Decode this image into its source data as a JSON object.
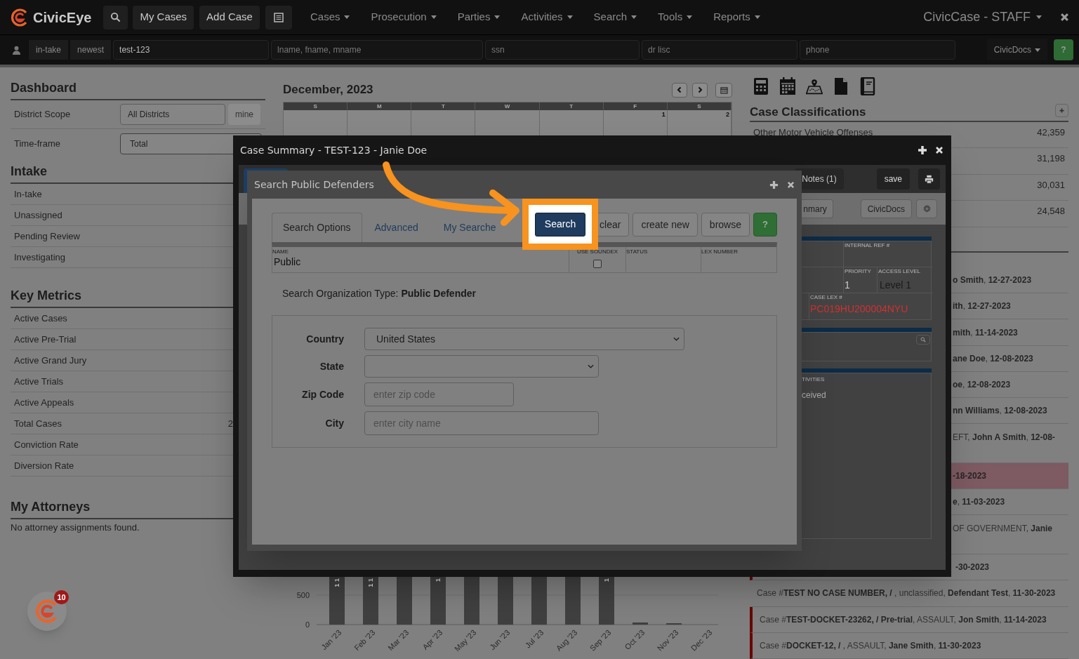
{
  "navbar": {
    "brand": "CivicEye",
    "buttons": [
      "My Cases",
      "Add Case"
    ],
    "menus": [
      "Cases",
      "Prosecution",
      "Parties",
      "Activities",
      "Search",
      "Tools",
      "Reports"
    ],
    "account": "CivicCase - STAFF"
  },
  "quick_search": {
    "buttons": [
      "in-take",
      "newest"
    ],
    "fields": [
      {
        "value": "test-123"
      },
      {
        "placeholder": "lname, fname, mname"
      },
      {
        "placeholder": "ssn"
      },
      {
        "placeholder": "dr lisc"
      },
      {
        "placeholder": "phone"
      }
    ],
    "docs_menu": "CivicDocs",
    "help": "?"
  },
  "dashboard": {
    "title": "Dashboard",
    "district_label": "District Scope",
    "district_value": "All Districts",
    "mine_button": "mine",
    "timeframe_label": "Time-frame",
    "timeframe_value": "Total"
  },
  "sections": [
    {
      "title": "Intake",
      "rows": [
        {
          "label": "In-take"
        },
        {
          "label": "Unassigned"
        },
        {
          "label": "Pending Review"
        },
        {
          "label": "Investigating"
        }
      ]
    },
    {
      "title": "Key Metrics",
      "rows": [
        {
          "label": "Active Cases"
        },
        {
          "label": "Active Pre-Trial"
        },
        {
          "label": "Active Grand Jury"
        },
        {
          "label": "Active Trials"
        },
        {
          "label": "Active Appeals"
        },
        {
          "label": "Total Cases",
          "value": "2"
        },
        {
          "label": "Conviction Rate"
        },
        {
          "label": "Diversion Rate"
        }
      ]
    }
  ],
  "attorneys": {
    "title": "My Attorneys",
    "message": "No attorney assignments found."
  },
  "calendar": {
    "title": "December, 2023",
    "weekdays": [
      "S",
      "M",
      "T",
      "W",
      "T",
      "F",
      "S"
    ],
    "first_week_dates": [
      "1",
      "2"
    ]
  },
  "chart": {
    "y_ticks": [
      "500",
      "0"
    ],
    "months": [
      {
        "label": "Jan '23",
        "kind": "tall",
        "bar_label": "1 1"
      },
      {
        "label": "Feb '23",
        "kind": "tall",
        "bar_label": "1 1"
      },
      {
        "label": "Mar '23",
        "kind": "tall"
      },
      {
        "label": "Apr '23",
        "kind": "tall",
        "bar_label": "1"
      },
      {
        "label": "May '23",
        "kind": "tall"
      },
      {
        "label": "Jun '23",
        "kind": "tall"
      },
      {
        "label": "Jul '23",
        "kind": "tall"
      },
      {
        "label": "Aug '23",
        "kind": "tall"
      },
      {
        "label": "Sep '23",
        "kind": "tall",
        "bar_label": "1"
      },
      {
        "label": "Oct '23",
        "kind": "low"
      },
      {
        "label": "Nov '23",
        "kind": "low"
      },
      {
        "label": "Dec '23",
        "kind": "none"
      }
    ]
  },
  "case_classifications": {
    "title": "Case Classifications",
    "rows": [
      {
        "name": "Other Motor Vehicle Offenses",
        "count": "42,359"
      },
      {
        "count": "31,198"
      },
      {
        "count": "30,031"
      },
      {
        "count": "24,548"
      }
    ]
  },
  "recent_cases": [
    {
      "kind": "partial",
      "text": "**o Smith**, **12-27-2023**",
      "highlighted": false,
      "marked": false
    },
    {
      "kind": "partial",
      "text": "**ith**, **12-27-2023**",
      "highlighted": false,
      "marked": false
    },
    {
      "kind": "partial",
      "text": "**mith**, **11-14-2023**",
      "highlighted": false,
      "marked": false
    },
    {
      "kind": "partial",
      "text": "**ane Doe**, **12-08-2023**",
      "highlighted": false,
      "marked": false
    },
    {
      "kind": "partial",
      "text": "**oe**, **12-08-2023**",
      "highlighted": false,
      "marked": false
    },
    {
      "kind": "partial",
      "text": "**nn Williams**, **12-08-2023**",
      "highlighted": false,
      "marked": false
    },
    {
      "kind": "partial_wrapped",
      "text": "EFT, **John A Smith**, **12-08-**",
      "highlighted": false,
      "marked": false
    },
    {
      "kind": "partial",
      "text": "**-18-2023**",
      "highlighted": true,
      "marked": false
    },
    {
      "kind": "partial",
      "text": "**e**, **11-03-2023**",
      "highlighted": false,
      "marked": false
    },
    {
      "kind": "partial_wrapped",
      "text": "OF GOVERNMENT, **Janie**",
      "highlighted": false,
      "marked": false
    },
    {
      "kind": "partial",
      "text": "**-30-2023**",
      "highlighted": false,
      "marked": true
    },
    {
      "kind": "full",
      "text": "Case #**TEST NO CASE NUMBER, /** , unclassified, **Defendant Test**, **11-30-2023**",
      "highlighted": false,
      "marked": false
    },
    {
      "kind": "full",
      "text": "Case #**TEST-DOCKET-23262, / Pre-trial**, ASSAULT, **Jon Smith**, **11-14-2023**",
      "highlighted": false,
      "marked": true
    },
    {
      "kind": "full",
      "text": "Case #**DOCKET-12, /** , ASSAULT, **Jane Smith**, **11-30-2023**",
      "highlighted": false,
      "marked": true
    }
  ],
  "case_summary": {
    "title": "Case Summary - TEST-123 - Janie Doe",
    "notes_tab": "Notes (1)",
    "save": "save",
    "toolbar_buttons": [
      "nmary",
      "CivicDocs"
    ],
    "internal_ref_label": "INTERNAL REF #",
    "priority_label": "PRIORITY",
    "priority": "1",
    "access_label": "ACCESS LEVEL",
    "access": "Level 1",
    "lex_label": "CASE LEX #",
    "lex": "PC019HU200004NYU",
    "activities_label": "TIVITIES",
    "activity": "ceived"
  },
  "search_dialog": {
    "title": "Search Public Defenders",
    "tabs": [
      {
        "label": "Search Options",
        "selected": true
      },
      {
        "label": "Advanced",
        "selected": false
      },
      {
        "label": "My Searche",
        "selected": false
      }
    ],
    "buttons": [
      {
        "label": "Search",
        "kind": "primary"
      },
      {
        "label": "clear",
        "kind": "default"
      },
      {
        "label": "create new",
        "kind": "default"
      },
      {
        "label": "browse",
        "kind": "default"
      },
      {
        "label": "?",
        "kind": "help"
      }
    ],
    "grid": {
      "columns": [
        "NAME",
        "USE SOUNDEX",
        "STATUS",
        "LEX NUMBER"
      ],
      "name_value": "Public",
      "use_soundex": false
    },
    "org_type": "Search Organization Type: **Public Defender**",
    "fields": [
      {
        "label": "Country",
        "kind": "select",
        "value": "United States"
      },
      {
        "label": "State",
        "kind": "select"
      },
      {
        "label": "Zip Code",
        "kind": "text",
        "placeholder": "enter zip code"
      },
      {
        "label": "City",
        "kind": "text",
        "placeholder": "enter city name"
      }
    ]
  },
  "chat_badge": "10"
}
